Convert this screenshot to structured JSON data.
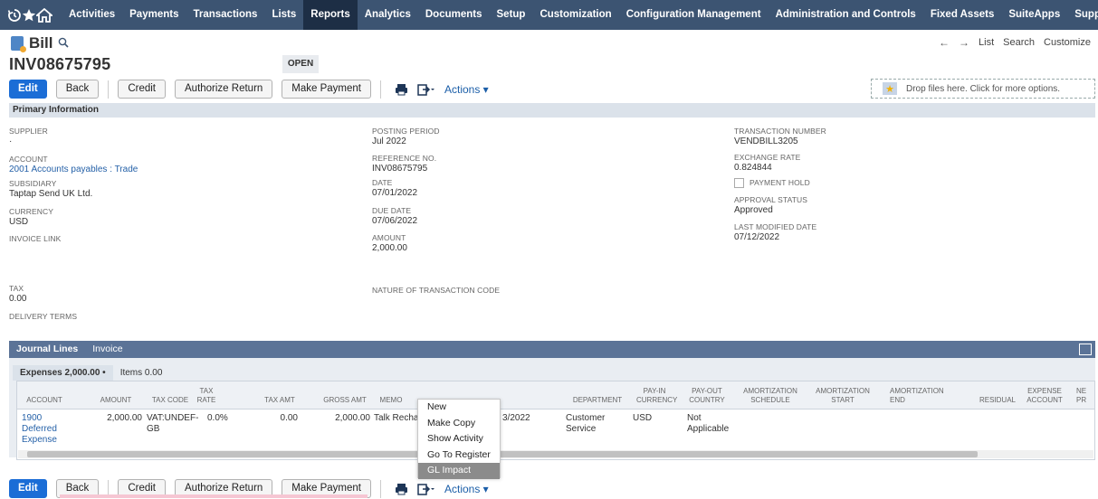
{
  "nav": {
    "icons": [
      "history-icon",
      "star-icon",
      "home-icon"
    ],
    "items": [
      "Activities",
      "Payments",
      "Transactions",
      "Lists",
      "Reports",
      "Analytics",
      "Documents",
      "Setup",
      "Customization",
      "Configuration Management",
      "Administration and Controls",
      "Fixed Assets",
      "SuiteApps",
      "Support"
    ],
    "active": "Reports"
  },
  "header": {
    "record_type": "Bill",
    "nav_links": [
      "List",
      "Search",
      "Customize"
    ],
    "number": "INV08675795",
    "status": "OPEN"
  },
  "buttons": {
    "edit": "Edit",
    "back": "Back",
    "credit": "Credit",
    "authorize_return": "Authorize Return",
    "make_payment": "Make Payment",
    "actions": "Actions ▾"
  },
  "dropzone": "Drop files here. Click for more options.",
  "primary": {
    "title": "Primary Information",
    "col1": [
      {
        "label": "SUPPLIER",
        "value": "·"
      },
      {
        "label": "ACCOUNT",
        "value": "2001 Accounts payables : Trade",
        "link": true
      },
      {
        "label": "SUBSIDIARY",
        "value": "Taptap Send UK Ltd."
      },
      {
        "label": "CURRENCY",
        "value": "USD"
      },
      {
        "label": "INVOICE LINK",
        "value": ""
      }
    ],
    "col2": [
      {
        "label": "POSTING PERIOD",
        "value": "Jul 2022"
      },
      {
        "label": "REFERENCE NO.",
        "value": "INV08675795"
      },
      {
        "label": "DATE",
        "value": "07/01/2022"
      },
      {
        "label": "DUE DATE",
        "value": "07/06/2022"
      },
      {
        "label": "AMOUNT",
        "value": "2,000.00"
      }
    ],
    "col3": [
      {
        "label": "TRANSACTION NUMBER",
        "value": "VENDBILL3205"
      },
      {
        "label": "EXCHANGE RATE",
        "value": "0.824844"
      },
      {
        "label": "PAYMENT HOLD",
        "value": ""
      },
      {
        "label": "APPROVAL STATUS",
        "value": "Approved"
      },
      {
        "label": "LAST MODIFIED DATE",
        "value": "07/12/2022"
      }
    ],
    "tax_label": "TAX",
    "tax_value": "0.00",
    "delivery_label": "DELIVERY TERMS",
    "nature_label": "NATURE OF TRANSACTION CODE"
  },
  "journal": {
    "tabs": [
      "Journal Lines",
      "Invoice"
    ],
    "subtabs": [
      "Expenses 2,000.00 •",
      "Items 0.00"
    ],
    "headers": [
      "ACCOUNT",
      "AMOUNT",
      "TAX CODE",
      "TAX RATE",
      "TAX AMT",
      "GROSS AMT",
      "MEMO",
      "DEPARTMENT",
      "PAY-IN CURRENCY",
      "PAY-OUT COUNTRY",
      "AMORTIZATION SCHEDULE",
      "AMORTIZATION START",
      "AMORTIZATION END",
      "RESIDUAL",
      "EXPENSE ACCOUNT",
      "NE PR"
    ],
    "row": {
      "account": "1900 Deferred Expense",
      "amount": "2,000.00",
      "tax_code": "VAT:UNDEF-GB",
      "tax_rate": "0.0%",
      "tax_amt": "0.00",
      "gross_amt": "2,000.00",
      "memo": "Talk Rechar",
      "date_tail": "3/2022",
      "department": "Customer Service",
      "payin": "USD",
      "payout": "Not Applicable"
    }
  },
  "context_menu": [
    "New",
    "Make Copy",
    "Show Activity",
    "Go To Register",
    "GL Impact"
  ]
}
